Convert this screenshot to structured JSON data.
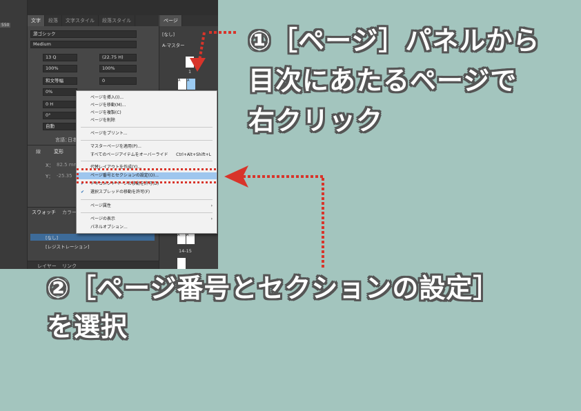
{
  "ruler": {
    "value": "550"
  },
  "char_panel": {
    "tabs": [
      "文字",
      "段落",
      "文字スタイル",
      "段落スタイル"
    ],
    "font_family": "游ゴシック",
    "font_style": "Medium",
    "size": "13 Q",
    "leading": "(22.75 H)",
    "vscale": "100%",
    "hscale": "100%",
    "kerning": "和文等幅",
    "tracking": "0",
    "tsume": "0%",
    "baseline": "0 H",
    "rotation": "0°",
    "auto": "自動",
    "lang_label": "言語：",
    "lang": "日本"
  },
  "mid_panel": {
    "tabs": [
      "線",
      "変形"
    ],
    "x_label": "X：",
    "x_value": "82.5 mm",
    "y_label": "Y：",
    "y_value": "-25.35"
  },
  "swatch_panel": {
    "tabs": [
      "スウォッチ",
      "カラー"
    ],
    "rows": [
      "[なし]",
      "[レジストレーション]"
    ]
  },
  "layer_panel": {
    "tabs": [
      "レイヤー",
      "リンク"
    ]
  },
  "pages_panel": {
    "title": "ページ",
    "none": "[なし]",
    "master": "A-マスター",
    "page1": "1",
    "spread": "14-15",
    "page_letter": "A"
  },
  "context_menu": {
    "items": [
      {
        "label": "ページを挿入(I)..."
      },
      {
        "label": "ページを移動(M)..."
      },
      {
        "label": "ページを複製(C)"
      },
      {
        "label": "ページを削除"
      },
      {
        "label": "ページをプリント..."
      },
      {
        "label": "マスターページを適用(P)..."
      },
      {
        "label": "すべてのページアイテムをオーバーライド",
        "shortcut": "Ctrl+Alt+Shift+L"
      },
      {
        "label": "代替レイアウトを作成(Y)..."
      },
      {
        "label": "ページ番号とセクションの設定(O)..."
      },
      {
        "label": "ドキュメントページの移動を許可(D)"
      },
      {
        "label": "選択スプレッドの移動を許可(F)"
      },
      {
        "label": "ページ属性"
      },
      {
        "label": "ページの表示"
      },
      {
        "label": "パネルオプション..."
      }
    ]
  },
  "callouts": {
    "step1_line1": "①［ページ］パネルから",
    "step1_line2": "目次にあたるページで",
    "step1_line3": "右クリック",
    "step2_line1": "②［ページ番号とセクションの設定］",
    "step2_line2": "を選択"
  },
  "colors": {
    "background": "#a3c5be",
    "highlight": "#9ec6ee",
    "arrow": "#d8342a",
    "text_outline": "#555555"
  }
}
